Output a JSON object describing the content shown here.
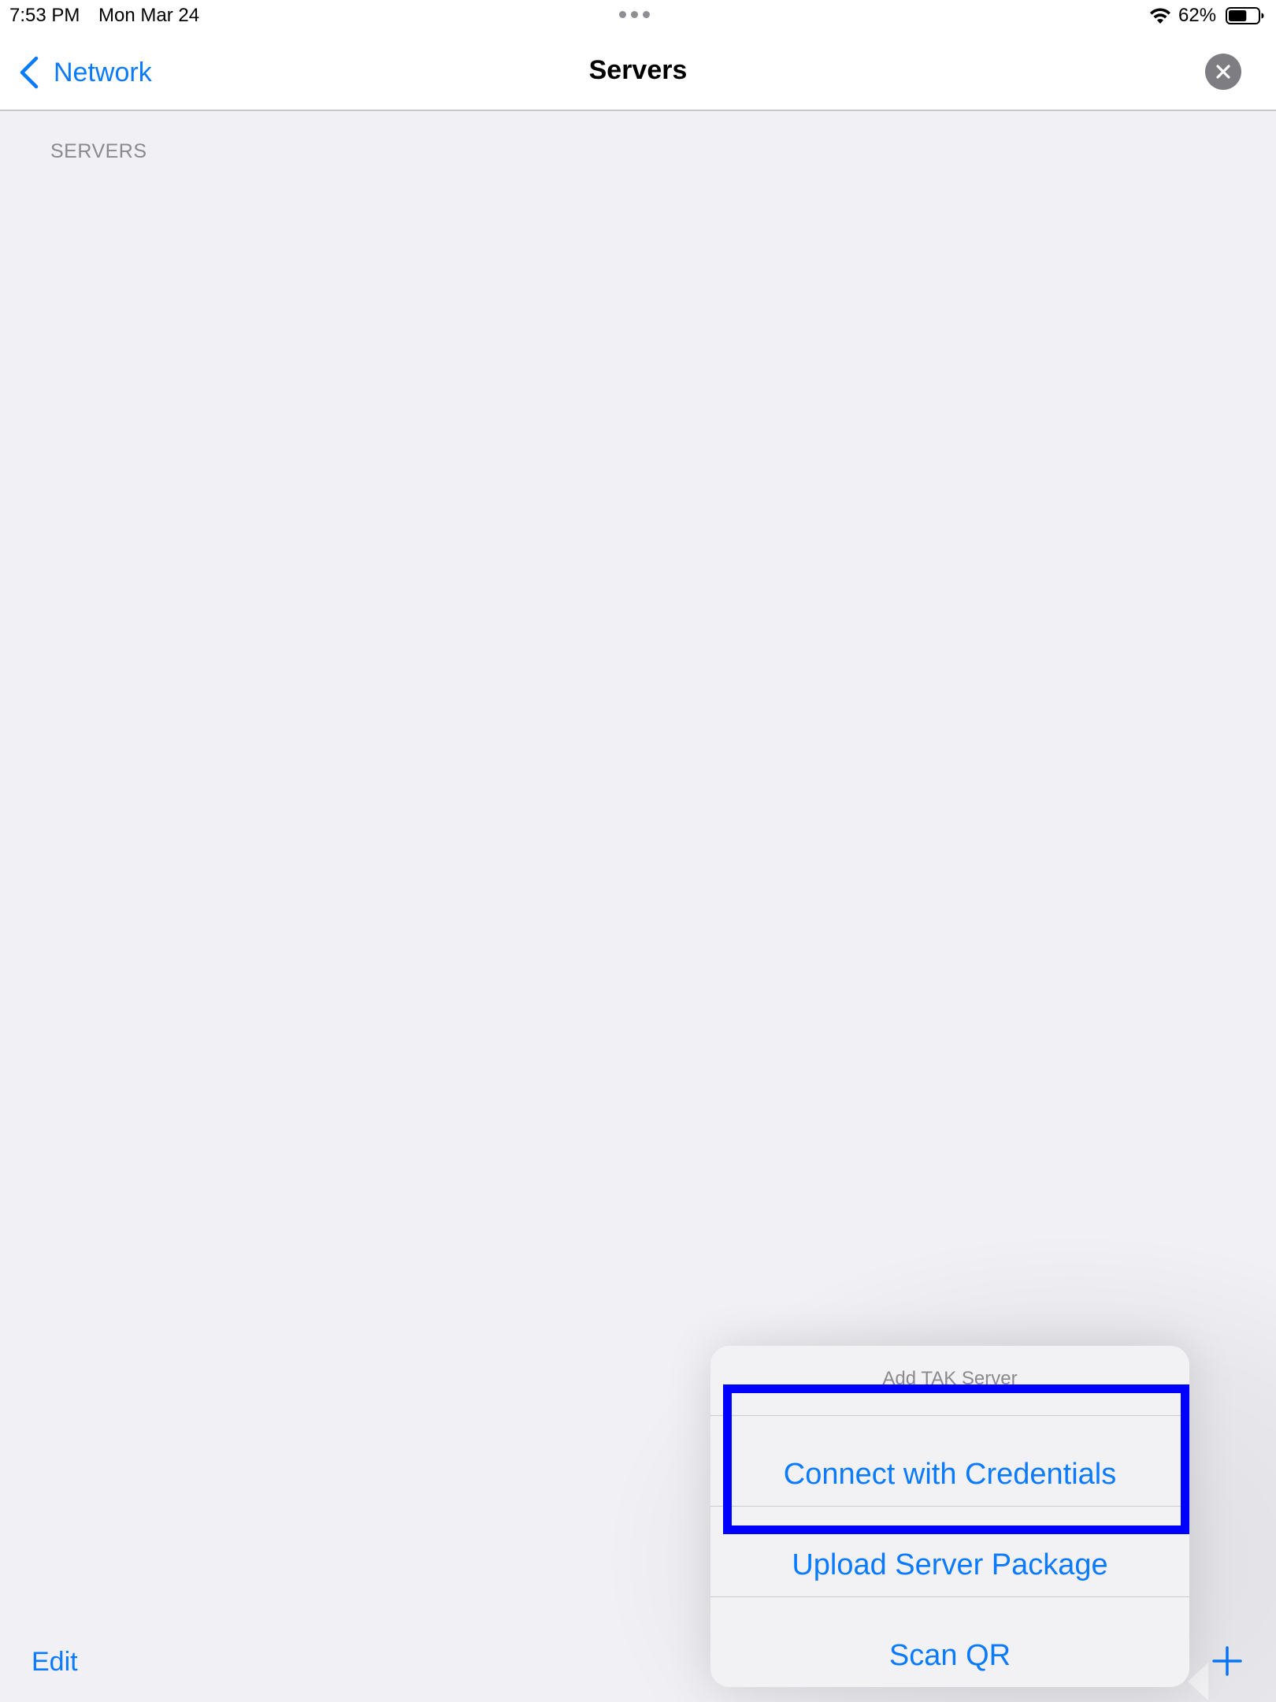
{
  "status_bar": {
    "time": "7:53 PM",
    "date": "Mon Mar 24",
    "battery_percent": "62%",
    "battery_level": 0.62
  },
  "nav": {
    "back_label": "Network",
    "title": "Servers"
  },
  "section": {
    "header": "SERVERS"
  },
  "toolbar": {
    "edit_label": "Edit"
  },
  "popover": {
    "title": "Add TAK Server",
    "items": [
      {
        "label": "Connect with Credentials"
      },
      {
        "label": "Upload Server Package"
      },
      {
        "label": "Scan QR"
      }
    ]
  },
  "colors": {
    "accent": "#0a7aff",
    "highlight": "#0000ff",
    "background": "#f0f0f5"
  },
  "icons": [
    "chevron-left-icon",
    "close-icon",
    "wifi-icon",
    "battery-icon",
    "plus-icon",
    "more-dots-icon"
  ]
}
